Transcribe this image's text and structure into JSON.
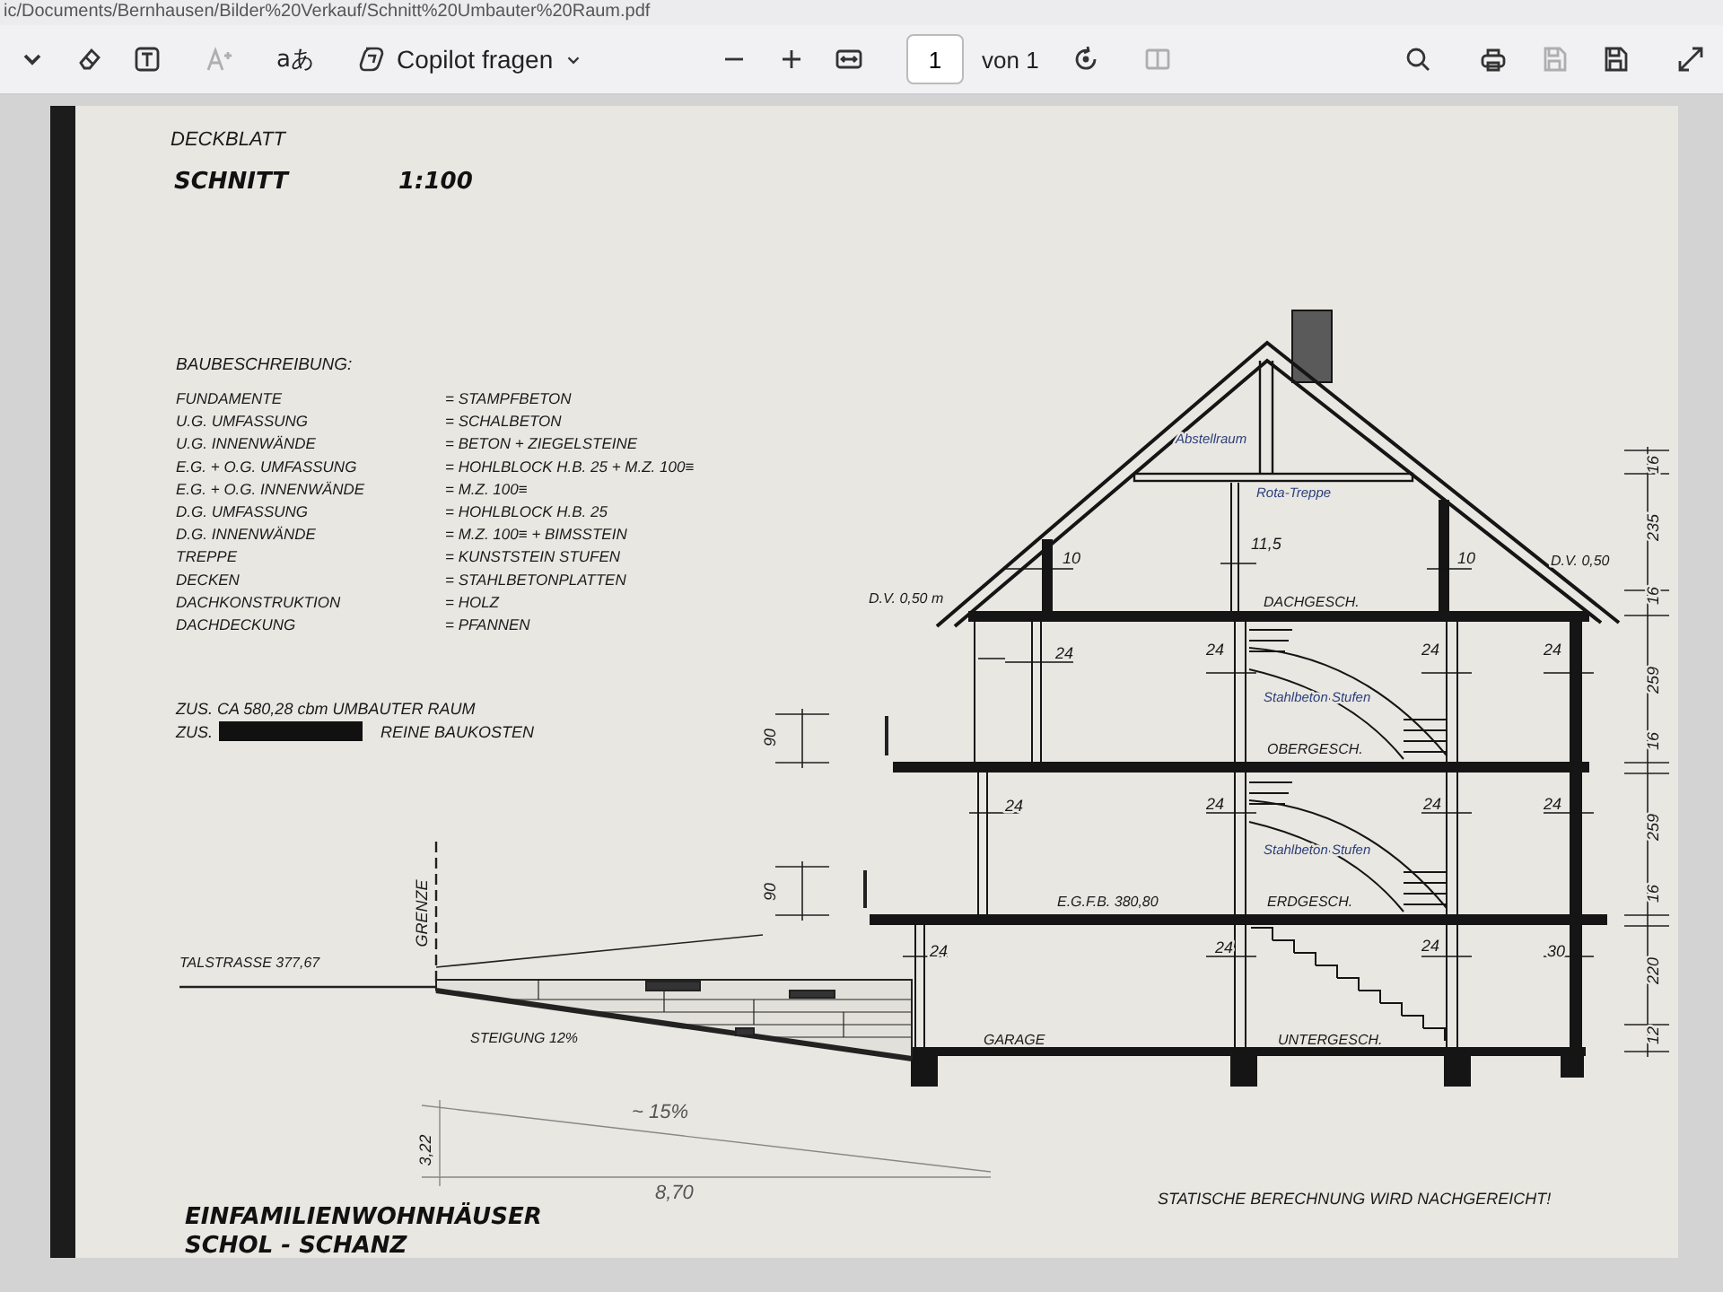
{
  "address_bar": {
    "url": "ic/Documents/Bernhausen/Bilder%20Verkauf/Schnitt%20Umbauter%20Raum.pdf"
  },
  "toolbar": {
    "items": [
      {
        "kind": "chevron",
        "disabled": false
      },
      {
        "kind": "eraser",
        "disabled": false
      },
      {
        "kind": "textbox",
        "disabled": false
      },
      {
        "kind": "font",
        "disabled": true
      },
      {
        "kind": "translate",
        "label": "aあ",
        "disabled": false
      },
      {
        "kind": "copilot",
        "label": "Copilot fragen",
        "disabled": false
      },
      {
        "kind": "zoom_out",
        "disabled": false
      },
      {
        "kind": "zoom_in",
        "disabled": false
      },
      {
        "kind": "fit",
        "disabled": false
      },
      {
        "kind": "page",
        "label": "1",
        "disabled": false
      },
      {
        "kind": "page_total",
        "label": "von 1",
        "disabled": false
      },
      {
        "kind": "rotate",
        "disabled": false
      },
      {
        "kind": "two_page",
        "disabled": true
      },
      {
        "kind": "search",
        "disabled": false
      },
      {
        "kind": "print",
        "disabled": false
      },
      {
        "kind": "save",
        "disabled": true
      },
      {
        "kind": "save_as",
        "disabled": false
      },
      {
        "kind": "expand",
        "disabled": false
      }
    ]
  },
  "plan": {
    "sheet_title": "DECKBLATT",
    "drawing_title": "SCHNITT",
    "scale": "1:100",
    "description_heading": "BAUBESCHREIBUNG:",
    "specs": [
      {
        "item": "FUNDAMENTE",
        "value": "= STAMPFBETON"
      },
      {
        "item": "U.G. UMFASSUNG",
        "value": "= SCHALBETON"
      },
      {
        "item": "U.G. INNENWÄNDE",
        "value": "= BETON + ZIEGELSTEINE"
      },
      {
        "item": "E.G. + O.G. UMFASSUNG",
        "value": "= HOHLBLOCK H.B. 25 + M.Z. 100≡"
      },
      {
        "item": "E.G. + O.G. INNENWÄNDE",
        "value": "= M.Z. 100≡"
      },
      {
        "item": "D.G. UMFASSUNG",
        "value": "= HOHLBLOCK H.B. 25"
      },
      {
        "item": "D.G. INNENWÄNDE",
        "value": "= M.Z. 100≡ + BIMSSTEIN"
      },
      {
        "item": "TREPPE",
        "value": "= KUNSTSTEIN STUFEN"
      },
      {
        "item": "DECKEN",
        "value": "= STAHLBETONPLATTEN"
      },
      {
        "item": "DACHKONSTRUKTION",
        "value": "= HOLZ"
      },
      {
        "item": "DACHDECKUNG",
        "value": "= PFANNEN"
      }
    ],
    "volume_line": "ZUS. CA 580,28 cbm UMBAUTER RAUM",
    "cost_prefix": "ZUS.",
    "cost_suffix": "REINE BAUKOSTEN",
    "labels": [
      {
        "text": "Abstellraum",
        "kind": "note"
      },
      {
        "text": "Rota-Treppe",
        "kind": "note"
      },
      {
        "text": "10",
        "kind": "dim"
      },
      {
        "text": "11,5",
        "kind": "dim"
      },
      {
        "text": "10",
        "kind": "dim"
      },
      {
        "text": "D.V. 0,50 m",
        "kind": "room"
      },
      {
        "text": "D.V. 0,50",
        "kind": "room"
      },
      {
        "text": "DACHGESCH.",
        "kind": "room"
      },
      {
        "text": "24",
        "kind": "dim"
      },
      {
        "text": "24",
        "kind": "dim"
      },
      {
        "text": "24",
        "kind": "dim"
      },
      {
        "text": "24",
        "kind": "dim"
      },
      {
        "text": "Stahlbeton Stufen",
        "kind": "note"
      },
      {
        "text": "OBERGESCH.",
        "kind": "room"
      },
      {
        "text": "24",
        "kind": "dim"
      },
      {
        "text": "24",
        "kind": "dim"
      },
      {
        "text": "24",
        "kind": "dim"
      },
      {
        "text": "24",
        "kind": "dim"
      },
      {
        "text": "Stahlbeton Stufen",
        "kind": "note"
      },
      {
        "text": "E.G.F.B. 380,80",
        "kind": "room"
      },
      {
        "text": "ERDGESCH.",
        "kind": "room"
      },
      {
        "text": "24",
        "kind": "dim"
      },
      {
        "text": "24",
        "kind": "dim"
      },
      {
        "text": "24",
        "kind": "dim"
      },
      {
        "text": "30",
        "kind": "dim"
      },
      {
        "text": "GARAGE",
        "kind": "room"
      },
      {
        "text": "UNTERGESCH.",
        "kind": "room"
      },
      {
        "text": "16",
        "kind": "vertical"
      },
      {
        "text": "235",
        "kind": "vertical"
      },
      {
        "text": "16",
        "kind": "vertical"
      },
      {
        "text": "259",
        "kind": "vertical"
      },
      {
        "text": "16",
        "kind": "vertical"
      },
      {
        "text": "259",
        "kind": "vertical"
      },
      {
        "text": "16",
        "kind": "vertical"
      },
      {
        "text": "220",
        "kind": "vertical"
      },
      {
        "text": "12",
        "kind": "vertical"
      },
      {
        "text": "90",
        "kind": "vertical"
      },
      {
        "text": "90",
        "kind": "vertical"
      },
      {
        "text": "GRENZE",
        "kind": "vertical"
      },
      {
        "text": "TALSTRASSE 377,67",
        "kind": "room"
      },
      {
        "text": "STEIGUNG 12%",
        "kind": "room"
      },
      {
        "text": "~ 15%",
        "kind": "pencil"
      },
      {
        "text": "3,22",
        "kind": "vertical"
      },
      {
        "text": "8,70",
        "kind": "pencil"
      }
    ],
    "project_line_1": "EINFAMILIENWOHNHÄUSER",
    "project_line_2": "SCHOL - SCHANZ",
    "footnote": "STATISCHE BERECHNUNG WIRD NACHGEREICHT!"
  }
}
